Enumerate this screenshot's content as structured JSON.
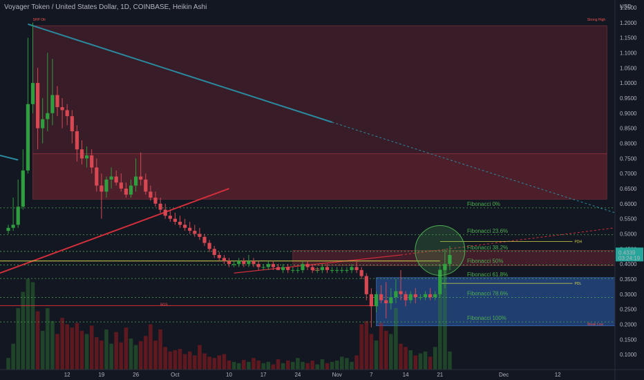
{
  "header": {
    "title": "Voyager Token / United States Dollar, 1D, COINBASE, Heikin Ashi"
  },
  "colors": {
    "background": "#131722",
    "up": "#26a69a",
    "down": "#ef5350",
    "candle_up": "#2e9e3e",
    "candle_down": "#d84852",
    "fib_green": "#4caf50",
    "supply_zone": "#9c2b3a",
    "demand_zone": "#2d5fb0",
    "yellow": "#d9d94a",
    "trend_blue": "#2a8aa0",
    "trend_red": "#d32f3a"
  },
  "price_badge": {
    "price": "0.4339",
    "countdown": "03:24:19"
  },
  "chart_data": {
    "type": "candlestick",
    "y_axis": {
      "unit": "USD",
      "ylim": [
        0.05,
        1.275
      ],
      "scale": "linear",
      "position": "right",
      "ticks": [
        1.25,
        1.2,
        1.15,
        1.1,
        1.05,
        1.0,
        0.95,
        0.9,
        0.85,
        0.8,
        0.75,
        0.7,
        0.65,
        0.6,
        0.55,
        0.5,
        0.45,
        0.4,
        0.35,
        0.3,
        0.25,
        0.2,
        0.15,
        0.1
      ],
      "tick_labels": [
        "1.2500",
        "1.2000",
        "1.1500",
        "1.1000",
        "1.0500",
        "1.0000",
        "0.9500",
        "0.9000",
        "0.8500",
        "0.8000",
        "0.7500",
        "0.7000",
        "0.6500",
        "0.6000",
        "0.5500",
        "0.5000",
        "0.4500",
        "0.4000",
        "0.3500",
        "0.3000",
        "0.2500",
        "0.2000",
        "0.1500",
        "0.1000"
      ]
    },
    "x_axis": {
      "ticks": [
        12,
        19,
        26,
        34,
        45,
        52,
        59,
        67,
        74,
        81,
        88,
        101,
        112
      ],
      "tick_labels": [
        "12",
        "19",
        "26",
        "Oct",
        "10",
        "17",
        "24",
        "Nov",
        "7",
        "14",
        "21",
        "Dec",
        "12"
      ]
    },
    "candles": [
      {
        "i": 0,
        "o": 0.51,
        "h": 0.53,
        "l": 0.5,
        "c": 0.52
      },
      {
        "i": 1,
        "o": 0.52,
        "h": 0.62,
        "l": 0.51,
        "c": 0.53
      },
      {
        "i": 2,
        "o": 0.53,
        "h": 0.68,
        "l": 0.52,
        "c": 0.59
      },
      {
        "i": 3,
        "o": 0.59,
        "h": 0.78,
        "l": 0.58,
        "c": 0.71
      },
      {
        "i": 4,
        "o": 0.71,
        "h": 1.15,
        "l": 0.7,
        "c": 0.93
      },
      {
        "i": 5,
        "o": 0.93,
        "h": 1.2,
        "l": 0.9,
        "c": 1.0
      },
      {
        "i": 6,
        "o": 1.0,
        "h": 1.05,
        "l": 0.78,
        "c": 0.85
      },
      {
        "i": 7,
        "o": 0.85,
        "h": 0.95,
        "l": 0.8,
        "c": 0.88
      },
      {
        "i": 8,
        "o": 0.88,
        "h": 1.1,
        "l": 0.84,
        "c": 0.9
      },
      {
        "i": 9,
        "o": 0.9,
        "h": 1.08,
        "l": 0.86,
        "c": 0.96
      },
      {
        "i": 10,
        "o": 0.96,
        "h": 0.99,
        "l": 0.89,
        "c": 0.92
      },
      {
        "i": 11,
        "o": 0.92,
        "h": 0.95,
        "l": 0.85,
        "c": 0.91
      },
      {
        "i": 12,
        "o": 0.91,
        "h": 0.93,
        "l": 0.86,
        "c": 0.89
      },
      {
        "i": 13,
        "o": 0.89,
        "h": 0.91,
        "l": 0.8,
        "c": 0.84
      },
      {
        "i": 14,
        "o": 0.84,
        "h": 0.86,
        "l": 0.74,
        "c": 0.78
      },
      {
        "i": 15,
        "o": 0.78,
        "h": 0.81,
        "l": 0.73,
        "c": 0.75
      },
      {
        "i": 16,
        "o": 0.75,
        "h": 0.79,
        "l": 0.72,
        "c": 0.76
      },
      {
        "i": 17,
        "o": 0.76,
        "h": 0.78,
        "l": 0.7,
        "c": 0.72
      },
      {
        "i": 18,
        "o": 0.72,
        "h": 0.75,
        "l": 0.64,
        "c": 0.66
      },
      {
        "i": 19,
        "o": 0.66,
        "h": 0.7,
        "l": 0.55,
        "c": 0.64
      },
      {
        "i": 20,
        "o": 0.64,
        "h": 0.69,
        "l": 0.62,
        "c": 0.68
      },
      {
        "i": 21,
        "o": 0.68,
        "h": 0.72,
        "l": 0.65,
        "c": 0.69
      },
      {
        "i": 22,
        "o": 0.69,
        "h": 0.71,
        "l": 0.66,
        "c": 0.67
      },
      {
        "i": 23,
        "o": 0.67,
        "h": 0.7,
        "l": 0.64,
        "c": 0.65
      },
      {
        "i": 24,
        "o": 0.65,
        "h": 0.67,
        "l": 0.62,
        "c": 0.63
      },
      {
        "i": 25,
        "o": 0.63,
        "h": 0.68,
        "l": 0.62,
        "c": 0.66
      },
      {
        "i": 26,
        "o": 0.66,
        "h": 0.75,
        "l": 0.64,
        "c": 0.69
      },
      {
        "i": 27,
        "o": 0.69,
        "h": 0.77,
        "l": 0.66,
        "c": 0.68
      },
      {
        "i": 28,
        "o": 0.68,
        "h": 0.7,
        "l": 0.63,
        "c": 0.64
      },
      {
        "i": 29,
        "o": 0.64,
        "h": 0.66,
        "l": 0.61,
        "c": 0.62
      },
      {
        "i": 30,
        "o": 0.62,
        "h": 0.64,
        "l": 0.59,
        "c": 0.6
      },
      {
        "i": 31,
        "o": 0.6,
        "h": 0.62,
        "l": 0.57,
        "c": 0.58
      },
      {
        "i": 32,
        "o": 0.58,
        "h": 0.6,
        "l": 0.55,
        "c": 0.56
      },
      {
        "i": 33,
        "o": 0.56,
        "h": 0.58,
        "l": 0.54,
        "c": 0.55
      },
      {
        "i": 34,
        "o": 0.55,
        "h": 0.57,
        "l": 0.53,
        "c": 0.54
      },
      {
        "i": 35,
        "o": 0.54,
        "h": 0.56,
        "l": 0.52,
        "c": 0.53
      },
      {
        "i": 36,
        "o": 0.53,
        "h": 0.55,
        "l": 0.51,
        "c": 0.52
      },
      {
        "i": 37,
        "o": 0.52,
        "h": 0.54,
        "l": 0.5,
        "c": 0.51
      },
      {
        "i": 38,
        "o": 0.51,
        "h": 0.53,
        "l": 0.49,
        "c": 0.5
      },
      {
        "i": 39,
        "o": 0.5,
        "h": 0.52,
        "l": 0.48,
        "c": 0.49
      },
      {
        "i": 40,
        "o": 0.49,
        "h": 0.5,
        "l": 0.46,
        "c": 0.47
      },
      {
        "i": 41,
        "o": 0.47,
        "h": 0.48,
        "l": 0.44,
        "c": 0.45
      },
      {
        "i": 42,
        "o": 0.45,
        "h": 0.46,
        "l": 0.42,
        "c": 0.43
      },
      {
        "i": 43,
        "o": 0.43,
        "h": 0.44,
        "l": 0.41,
        "c": 0.42
      },
      {
        "i": 44,
        "o": 0.42,
        "h": 0.43,
        "l": 0.4,
        "c": 0.41
      },
      {
        "i": 45,
        "o": 0.41,
        "h": 0.42,
        "l": 0.39,
        "c": 0.4
      },
      {
        "i": 46,
        "o": 0.4,
        "h": 0.41,
        "l": 0.39,
        "c": 0.4
      },
      {
        "i": 47,
        "o": 0.4,
        "h": 0.42,
        "l": 0.39,
        "c": 0.41
      },
      {
        "i": 48,
        "o": 0.41,
        "h": 0.42,
        "l": 0.39,
        "c": 0.4
      },
      {
        "i": 49,
        "o": 0.4,
        "h": 0.43,
        "l": 0.39,
        "c": 0.41
      },
      {
        "i": 50,
        "o": 0.41,
        "h": 0.42,
        "l": 0.39,
        "c": 0.4
      },
      {
        "i": 51,
        "o": 0.4,
        "h": 0.41,
        "l": 0.38,
        "c": 0.39
      },
      {
        "i": 52,
        "o": 0.39,
        "h": 0.4,
        "l": 0.38,
        "c": 0.39
      },
      {
        "i": 53,
        "o": 0.39,
        "h": 0.41,
        "l": 0.38,
        "c": 0.4
      },
      {
        "i": 54,
        "o": 0.4,
        "h": 0.41,
        "l": 0.38,
        "c": 0.39
      },
      {
        "i": 55,
        "o": 0.39,
        "h": 0.4,
        "l": 0.38,
        "c": 0.38
      },
      {
        "i": 56,
        "o": 0.38,
        "h": 0.4,
        "l": 0.37,
        "c": 0.39
      },
      {
        "i": 57,
        "o": 0.39,
        "h": 0.4,
        "l": 0.37,
        "c": 0.38
      },
      {
        "i": 58,
        "o": 0.38,
        "h": 0.39,
        "l": 0.37,
        "c": 0.38
      },
      {
        "i": 59,
        "o": 0.38,
        "h": 0.39,
        "l": 0.37,
        "c": 0.38
      },
      {
        "i": 60,
        "o": 0.38,
        "h": 0.41,
        "l": 0.37,
        "c": 0.4
      },
      {
        "i": 61,
        "o": 0.4,
        "h": 0.41,
        "l": 0.38,
        "c": 0.39
      },
      {
        "i": 62,
        "o": 0.39,
        "h": 0.4,
        "l": 0.37,
        "c": 0.38
      },
      {
        "i": 63,
        "o": 0.38,
        "h": 0.39,
        "l": 0.37,
        "c": 0.38
      },
      {
        "i": 64,
        "o": 0.38,
        "h": 0.4,
        "l": 0.37,
        "c": 0.39
      },
      {
        "i": 65,
        "o": 0.39,
        "h": 0.4,
        "l": 0.37,
        "c": 0.38
      },
      {
        "i": 66,
        "o": 0.38,
        "h": 0.39,
        "l": 0.37,
        "c": 0.38
      },
      {
        "i": 67,
        "o": 0.38,
        "h": 0.39,
        "l": 0.37,
        "c": 0.38
      },
      {
        "i": 68,
        "o": 0.38,
        "h": 0.39,
        "l": 0.37,
        "c": 0.38
      },
      {
        "i": 69,
        "o": 0.38,
        "h": 0.39,
        "l": 0.37,
        "c": 0.38
      },
      {
        "i": 70,
        "o": 0.38,
        "h": 0.4,
        "l": 0.37,
        "c": 0.39
      },
      {
        "i": 71,
        "o": 0.39,
        "h": 0.41,
        "l": 0.37,
        "c": 0.38
      },
      {
        "i": 72,
        "o": 0.38,
        "h": 0.39,
        "l": 0.35,
        "c": 0.36
      },
      {
        "i": 73,
        "o": 0.36,
        "h": 0.37,
        "l": 0.28,
        "c": 0.3
      },
      {
        "i": 74,
        "o": 0.3,
        "h": 0.32,
        "l": 0.19,
        "c": 0.26
      },
      {
        "i": 75,
        "o": 0.26,
        "h": 0.31,
        "l": 0.24,
        "c": 0.3
      },
      {
        "i": 76,
        "o": 0.3,
        "h": 0.33,
        "l": 0.27,
        "c": 0.28
      },
      {
        "i": 77,
        "o": 0.28,
        "h": 0.34,
        "l": 0.22,
        "c": 0.27
      },
      {
        "i": 78,
        "o": 0.27,
        "h": 0.32,
        "l": 0.25,
        "c": 0.29
      },
      {
        "i": 79,
        "o": 0.29,
        "h": 0.35,
        "l": 0.27,
        "c": 0.31
      },
      {
        "i": 80,
        "o": 0.31,
        "h": 0.38,
        "l": 0.28,
        "c": 0.3
      },
      {
        "i": 81,
        "o": 0.3,
        "h": 0.31,
        "l": 0.26,
        "c": 0.28
      },
      {
        "i": 82,
        "o": 0.28,
        "h": 0.31,
        "l": 0.27,
        "c": 0.3
      },
      {
        "i": 83,
        "o": 0.3,
        "h": 0.32,
        "l": 0.27,
        "c": 0.29
      },
      {
        "i": 84,
        "o": 0.29,
        "h": 0.3,
        "l": 0.28,
        "c": 0.29
      },
      {
        "i": 85,
        "o": 0.29,
        "h": 0.31,
        "l": 0.28,
        "c": 0.3
      },
      {
        "i": 86,
        "o": 0.3,
        "h": 0.32,
        "l": 0.28,
        "c": 0.29
      },
      {
        "i": 87,
        "o": 0.29,
        "h": 0.31,
        "l": 0.28,
        "c": 0.3
      },
      {
        "i": 88,
        "o": 0.3,
        "h": 0.4,
        "l": 0.29,
        "c": 0.38
      },
      {
        "i": 89,
        "o": 0.38,
        "h": 0.45,
        "l": 0.32,
        "c": 0.4
      },
      {
        "i": 90,
        "o": 0.4,
        "h": 0.46,
        "l": 0.38,
        "c": 0.43
      }
    ],
    "volume": [
      18,
      40,
      95,
      120,
      140,
      135,
      90,
      60,
      95,
      75,
      55,
      80,
      70,
      65,
      72,
      60,
      55,
      68,
      50,
      45,
      62,
      40,
      58,
      42,
      65,
      48,
      38,
      44,
      52,
      70,
      45,
      62,
      35,
      28,
      30,
      32,
      24,
      28,
      22,
      38,
      25,
      20,
      18,
      22,
      24,
      14,
      12,
      10,
      15,
      12,
      18,
      14,
      10,
      12,
      8,
      16,
      10,
      14,
      12,
      18,
      12,
      10,
      14,
      8,
      16,
      10,
      12,
      14,
      20,
      18,
      12,
      22,
      70,
      75,
      55,
      45,
      72,
      60,
      55,
      95,
      40,
      35,
      30,
      22,
      25,
      28,
      20,
      35,
      155,
      160,
      28
    ],
    "fibonacci": [
      {
        "label": "Fibonacci 0%",
        "value": 0.586
      },
      {
        "label": "Fibonacci 23.6%",
        "value": 0.497
      },
      {
        "label": "Fibonacci 38.2%",
        "value": 0.442
      },
      {
        "label": "Fibonacci 50%",
        "value": 0.397
      },
      {
        "label": "Fibonacci 61.8%",
        "value": 0.352
      },
      {
        "label": "Fibonacci 78.6%",
        "value": 0.289
      },
      {
        "label": "Fibonacci 100%",
        "value": 0.208
      }
    ],
    "levels": [
      {
        "label": "PDH",
        "value": 0.475,
        "color": "#d9d94a"
      },
      {
        "label": "PDL",
        "value": 0.336,
        "color": "#d9d94a"
      }
    ],
    "zones": [
      {
        "name": "supply-top",
        "y1": 0.765,
        "y2": 1.19,
        "i1": 5,
        "i2": 122
      },
      {
        "name": "supply-mid",
        "y1": 0.615,
        "y2": 0.765,
        "i1": 5,
        "i2": 122
      },
      {
        "name": "ob-zone",
        "y1": 0.395,
        "y2": 0.445,
        "i1": 58,
        "i2": 124
      },
      {
        "name": "demand-zone",
        "y1": 0.195,
        "y2": 0.355,
        "i1": 75,
        "i2": 124
      }
    ],
    "annotations": [
      {
        "text": "SHP Ob",
        "x": 5,
        "y": 1.2
      },
      {
        "text": "Strong High",
        "x": 118,
        "y": 1.2
      },
      {
        "text": "BOS",
        "x": 31,
        "y": 0.255
      },
      {
        "text": "BOS",
        "x": 62,
        "y": 0.37
      },
      {
        "text": "Weak Low",
        "x": 118,
        "y": 0.19
      }
    ]
  }
}
